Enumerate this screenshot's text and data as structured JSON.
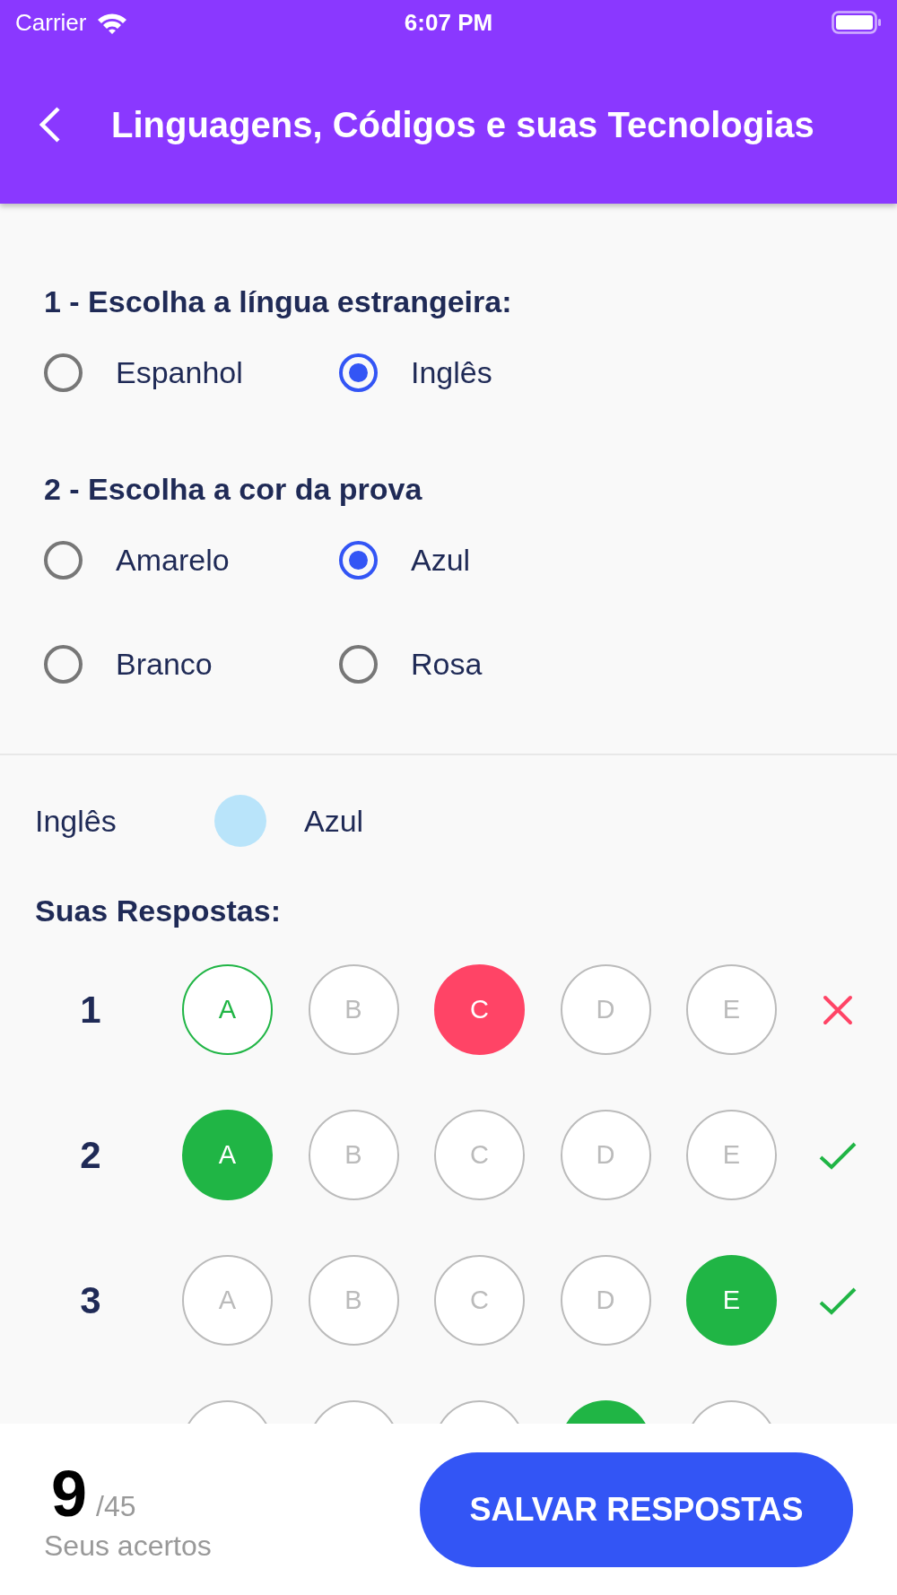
{
  "status_bar": {
    "carrier": "Carrier",
    "time": "6:07 PM"
  },
  "header": {
    "title": "Linguagens, Códigos e suas Tecnologias"
  },
  "questions": [
    {
      "title": "1 - Escolha a língua estrangeira:",
      "options": [
        {
          "label": "Espanhol",
          "selected": false
        },
        {
          "label": "Inglês",
          "selected": true
        }
      ]
    },
    {
      "title": "2 - Escolha a cor da prova",
      "options": [
        {
          "label": "Amarelo",
          "selected": false
        },
        {
          "label": "Azul",
          "selected": true
        },
        {
          "label": "Branco",
          "selected": false
        },
        {
          "label": "Rosa",
          "selected": false
        }
      ]
    }
  ],
  "summary": {
    "language": "Inglês",
    "color": "#b9e4fa",
    "color_name": "Azul"
  },
  "answers": {
    "title": "Suas Respostas:",
    "rows": [
      {
        "number": "1",
        "correct": false,
        "options": [
          {
            "letter": "A",
            "selected": false,
            "correct": true
          },
          {
            "letter": "B",
            "selected": false,
            "correct": false
          },
          {
            "letter": "C",
            "selected": true,
            "correct": false
          },
          {
            "letter": "D",
            "selected": false,
            "correct": false
          },
          {
            "letter": "E",
            "selected": false,
            "correct": false
          }
        ]
      },
      {
        "number": "2",
        "correct": true,
        "options": [
          {
            "letter": "A",
            "selected": true,
            "correct": true
          },
          {
            "letter": "B",
            "selected": false,
            "correct": false
          },
          {
            "letter": "C",
            "selected": false,
            "correct": false
          },
          {
            "letter": "D",
            "selected": false,
            "correct": false
          },
          {
            "letter": "E",
            "selected": false,
            "correct": false
          }
        ]
      },
      {
        "number": "3",
        "correct": true,
        "options": [
          {
            "letter": "A",
            "selected": false,
            "correct": false
          },
          {
            "letter": "B",
            "selected": false,
            "correct": false
          },
          {
            "letter": "C",
            "selected": false,
            "correct": false
          },
          {
            "letter": "D",
            "selected": false,
            "correct": false
          },
          {
            "letter": "E",
            "selected": true,
            "correct": true
          }
        ]
      },
      {
        "options": [
          {
            "selected": false,
            "correct": false
          },
          {
            "selected": false,
            "correct": false
          },
          {
            "selected": false,
            "correct": false
          },
          {
            "selected": true,
            "correct": true
          },
          {
            "selected": false,
            "correct": false
          }
        ]
      }
    ]
  },
  "footer": {
    "score": "9",
    "total": "/45",
    "caption": "Seus acertos",
    "button": "SALVAR RESPOSTAS"
  }
}
